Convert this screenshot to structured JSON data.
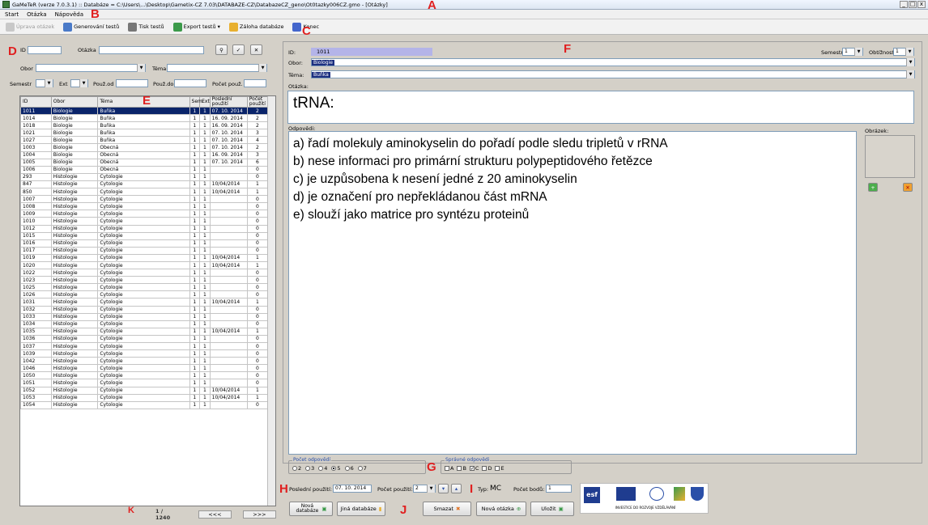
{
  "titlebar": {
    "title": "GaMeTeR (verze 7.0.3.1) :: Databáze = C:\\Users\\...\\Desktop\\Gametix-CZ 7.03\\DATABAZE-CZ\\DatabazeCZ_geno\\Ot0tazky006CZ.gmo - [Otázky]"
  },
  "menu": [
    "Start",
    "Otázka",
    "Nápověda"
  ],
  "toolbar": {
    "items": [
      "Úprava otázek",
      "Generování testů",
      "Tisk testů",
      "Export testů ▾",
      "Záloha databáze",
      "Konec"
    ]
  },
  "markers": {
    "A": "A",
    "B": "B",
    "C": "C",
    "D": "D",
    "E": "E",
    "F": "F",
    "G": "G",
    "H": "H",
    "I": "I",
    "J": "J",
    "K": "K"
  },
  "filter": {
    "id_label": "ID",
    "otazka_label": "Otázka",
    "obor_label": "Obor",
    "tema_label": "Téma",
    "semestr_label": "Semestr",
    "ext_label": "Ext",
    "pouzd_label": "Použ.od",
    "pouzdo_label": "Použ.do",
    "pocet_label": "Počet použ."
  },
  "grid": {
    "headers": [
      "ID",
      "Obor",
      "Téma",
      "Sem",
      "Ext",
      "Poslední použití",
      "Počet použití"
    ],
    "rows": [
      [
        "1011",
        "Biologie",
        "Buňka",
        "1",
        "1",
        "07. 10. 2014",
        "2"
      ],
      [
        "1014",
        "Biologie",
        "Buňka",
        "1",
        "1",
        "16. 09. 2014",
        "2"
      ],
      [
        "1018",
        "Biologie",
        "Buňka",
        "1",
        "1",
        "16. 09. 2014",
        "2"
      ],
      [
        "1021",
        "Biologie",
        "Buňka",
        "1",
        "1",
        "07. 10. 2014",
        "3"
      ],
      [
        "1027",
        "Biologie",
        "Buňka",
        "1",
        "1",
        "07. 10. 2014",
        "4"
      ],
      [
        "1003",
        "Biologie",
        "Obecná",
        "1",
        "1",
        "07. 10. 2014",
        "2"
      ],
      [
        "1004",
        "Biologie",
        "Obecná",
        "1",
        "1",
        "16. 09. 2014",
        "3"
      ],
      [
        "1005",
        "Biologie",
        "Obecná",
        "1",
        "1",
        "07. 10. 2014",
        "6"
      ],
      [
        "1006",
        "Biologie",
        "Obecná",
        "1",
        "1",
        "",
        "0"
      ],
      [
        "293",
        "Histologie",
        "Cytologie",
        "1",
        "1",
        "",
        "0"
      ],
      [
        "847",
        "Histologie",
        "Cytologie",
        "1",
        "1",
        "10/04/2014",
        "1"
      ],
      [
        "850",
        "Histologie",
        "Cytologie",
        "1",
        "1",
        "10/04/2014",
        "1"
      ],
      [
        "1007",
        "Histologie",
        "Cytologie",
        "1",
        "1",
        "",
        "0"
      ],
      [
        "1008",
        "Histologie",
        "Cytologie",
        "1",
        "1",
        "",
        "0"
      ],
      [
        "1009",
        "Histologie",
        "Cytologie",
        "1",
        "1",
        "",
        "0"
      ],
      [
        "1010",
        "Histologie",
        "Cytologie",
        "1",
        "1",
        "",
        "0"
      ],
      [
        "1012",
        "Histologie",
        "Cytologie",
        "1",
        "1",
        "",
        "0"
      ],
      [
        "1015",
        "Histologie",
        "Cytologie",
        "1",
        "1",
        "",
        "0"
      ],
      [
        "1016",
        "Histologie",
        "Cytologie",
        "1",
        "1",
        "",
        "0"
      ],
      [
        "1017",
        "Histologie",
        "Cytologie",
        "1",
        "1",
        "",
        "0"
      ],
      [
        "1019",
        "Histologie",
        "Cytologie",
        "1",
        "1",
        "10/04/2014",
        "1"
      ],
      [
        "1020",
        "Histologie",
        "Cytologie",
        "1",
        "1",
        "10/04/2014",
        "1"
      ],
      [
        "1022",
        "Histologie",
        "Cytologie",
        "1",
        "1",
        "",
        "0"
      ],
      [
        "1023",
        "Histologie",
        "Cytologie",
        "1",
        "1",
        "",
        "0"
      ],
      [
        "1025",
        "Histologie",
        "Cytologie",
        "1",
        "1",
        "",
        "0"
      ],
      [
        "1026",
        "Histologie",
        "Cytologie",
        "1",
        "1",
        "",
        "0"
      ],
      [
        "1031",
        "Histologie",
        "Cytologie",
        "1",
        "1",
        "10/04/2014",
        "1"
      ],
      [
        "1032",
        "Histologie",
        "Cytologie",
        "1",
        "1",
        "",
        "0"
      ],
      [
        "1033",
        "Histologie",
        "Cytologie",
        "1",
        "1",
        "",
        "0"
      ],
      [
        "1034",
        "Histologie",
        "Cytologie",
        "1",
        "1",
        "",
        "0"
      ],
      [
        "1035",
        "Histologie",
        "Cytologie",
        "1",
        "1",
        "10/04/2014",
        "1"
      ],
      [
        "1036",
        "Histologie",
        "Cytologie",
        "1",
        "1",
        "",
        "0"
      ],
      [
        "1037",
        "Histologie",
        "Cytologie",
        "1",
        "1",
        "",
        "0"
      ],
      [
        "1039",
        "Histologie",
        "Cytologie",
        "1",
        "1",
        "",
        "0"
      ],
      [
        "1042",
        "Histologie",
        "Cytologie",
        "1",
        "1",
        "",
        "0"
      ],
      [
        "1046",
        "Histologie",
        "Cytologie",
        "1",
        "1",
        "",
        "0"
      ],
      [
        "1050",
        "Histologie",
        "Cytologie",
        "1",
        "1",
        "",
        "0"
      ],
      [
        "1051",
        "Histologie",
        "Cytologie",
        "1",
        "1",
        "",
        "0"
      ],
      [
        "1052",
        "Histologie",
        "Cytologie",
        "1",
        "1",
        "10/04/2014",
        "1"
      ],
      [
        "1053",
        "Histologie",
        "Cytologie",
        "1",
        "1",
        "10/04/2014",
        "1"
      ],
      [
        "1054",
        "Histologie",
        "Cytologie",
        "1",
        "1",
        "",
        "0"
      ]
    ]
  },
  "pager": {
    "count": "1 / 1240",
    "prev": "<<<",
    "next": ">>>"
  },
  "detail": {
    "id_label": "ID:",
    "id_value": "1011",
    "obor_label": "Obor:",
    "obor_value": "Biologie",
    "tema_label": "Téma:",
    "tema_value": "Buňka",
    "semestr_label": "Semestr:",
    "semestr_value": "1",
    "obtiznost_label": "Obtížnost:",
    "obtiznost_value": "1",
    "otazka_label": "Otázka:",
    "otazka_text": "tRNA:",
    "odpovedi_label": "Odpovědi:",
    "obrazek_label": "Obrázek:",
    "answers": [
      "a) řadí molekuly aminokyselin do pořadí podle sledu tripletů v rRNA",
      "b) nese informaci pro primární strukturu polypeptidového řetězce",
      "c) je uzpůsobena k nesení jedné z 20 aminokyselin",
      "d) je označení pro nepřekládanou část mRNA",
      "e) slouží jako matrice pro syntézu proteinů"
    ]
  },
  "answer_count": {
    "label": "Počet odpovědí",
    "options": [
      "2",
      "3",
      "4",
      "5",
      "6",
      "7"
    ],
    "selected": "5"
  },
  "correct": {
    "label": "Správné odpovědi",
    "options": [
      "A",
      "B",
      "C",
      "D",
      "E"
    ],
    "checked": [
      "C"
    ]
  },
  "usage": {
    "last_label": "Poslední použití:",
    "last_value": "07. 10. 2014",
    "count_label": "Počet použití:",
    "count_value": "2",
    "type_label": "Typ:",
    "type_value": "MC",
    "points_label": "Počet bodů:",
    "points_value": "1"
  },
  "buttons": {
    "new_db": "Nová databáze",
    "other_db": "Jiná databáze",
    "delete": "Smazat",
    "new_question": "Nová otázka",
    "save": "Uložit"
  },
  "logos": {
    "esf": "esf",
    "caption": "INVESTICE DO ROZVOJE VZDĚLÁVÁNÍ"
  },
  "colors": {
    "selection": "#0a246a",
    "marker": "#e02020",
    "field_highlight": "#b4b4e8"
  }
}
